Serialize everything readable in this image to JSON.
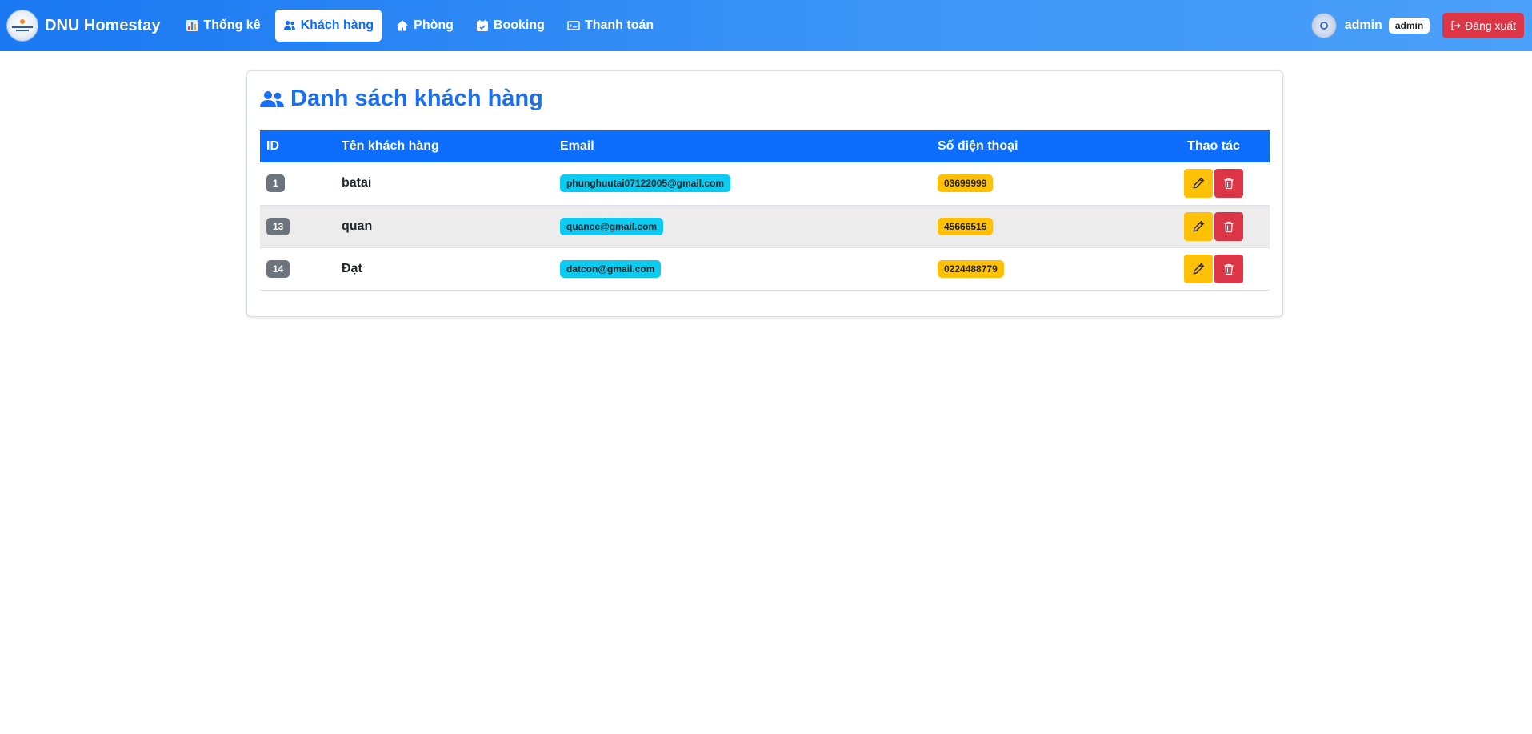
{
  "brand": {
    "name": "DNU Homestay"
  },
  "nav": {
    "items": [
      {
        "label": "Thống kê",
        "icon": "chart-icon",
        "active": false
      },
      {
        "label": "Khách hàng",
        "icon": "users-icon",
        "active": true
      },
      {
        "label": "Phòng",
        "icon": "home-icon",
        "active": false
      },
      {
        "label": "Booking",
        "icon": "calendar-icon",
        "active": false
      },
      {
        "label": "Thanh toán",
        "icon": "payment-icon",
        "active": false
      }
    ]
  },
  "user": {
    "name": "admin",
    "role": "admin",
    "logout_label": "Đăng xuất"
  },
  "page": {
    "title": "Danh sách khách hàng"
  },
  "table": {
    "headers": {
      "id": "ID",
      "name": "Tên khách hàng",
      "email": "Email",
      "phone": "Số điện thoại",
      "actions": "Thao tác"
    },
    "rows": [
      {
        "id": "1",
        "name": "batai",
        "email": "phunghuutai07122005@gmail.com",
        "phone": "03699999"
      },
      {
        "id": "13",
        "name": "quan",
        "email": "quancc@gmail.com",
        "phone": "45666515"
      },
      {
        "id": "14",
        "name": "Đạt",
        "email": "datcon@gmail.com",
        "phone": "0224488779"
      }
    ]
  },
  "colors": {
    "primary": "#0d6efd",
    "danger": "#dc3545",
    "warning": "#ffc107",
    "info": "#0dcaf0",
    "secondary": "#6c757d"
  }
}
